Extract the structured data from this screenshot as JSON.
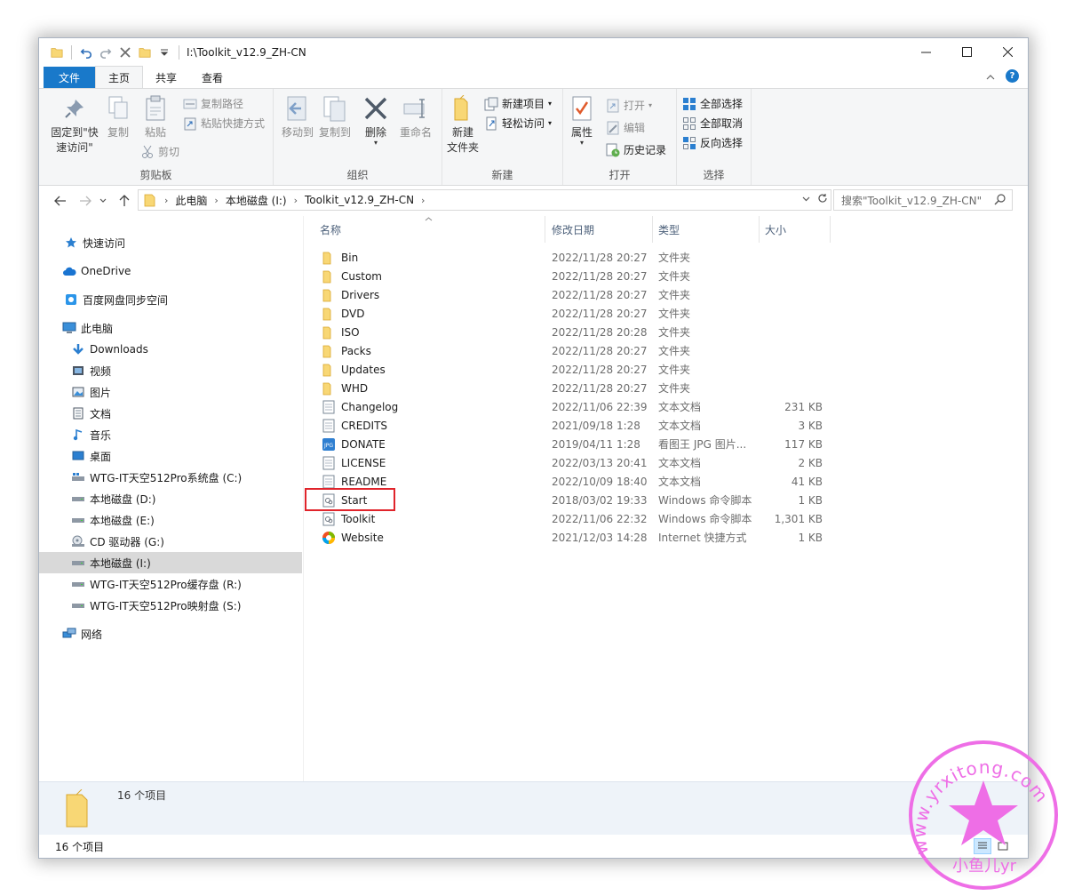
{
  "window": {
    "title": "I:\\Toolkit_v12.9_ZH-CN"
  },
  "tabs": [
    {
      "label": "文件"
    },
    {
      "label": "主页"
    },
    {
      "label": "共享"
    },
    {
      "label": "查看"
    }
  ],
  "ribbon": {
    "clipboard": {
      "pin_line1": "固定到\"快",
      "pin_line2": "速访问\"",
      "copy": "复制",
      "paste": "粘贴",
      "copy_path": "复制路径",
      "paste_shortcut": "粘贴快捷方式",
      "cut": "剪切",
      "label": "剪贴板"
    },
    "organize": {
      "move_to": "移动到",
      "copy_to": "复制到",
      "delete": "删除",
      "rename": "重命名",
      "label": "组织"
    },
    "new": {
      "new_folder_line1": "新建",
      "new_folder_line2": "文件夹",
      "new_item": "新建项目",
      "easy_access": "轻松访问",
      "label": "新建"
    },
    "open": {
      "properties": "属性",
      "open": "打开",
      "edit": "编辑",
      "history": "历史记录",
      "label": "打开"
    },
    "select": {
      "select_all": "全部选择",
      "select_none": "全部取消",
      "invert": "反向选择",
      "label": "选择"
    }
  },
  "address": {
    "crumbs": [
      "此电脑",
      "本地磁盘 (I:)",
      "Toolkit_v12.9_ZH-CN"
    ],
    "search_placeholder": "搜索\"Toolkit_v12.9_ZH-CN\""
  },
  "nav": {
    "items": [
      {
        "label": "快速访问",
        "icon": "star-icon"
      },
      {
        "label": "OneDrive",
        "icon": "cloud-icon"
      },
      {
        "label": "百度网盘同步空间",
        "icon": "baidu-icon"
      },
      {
        "label": "此电脑",
        "icon": "computer-icon"
      },
      {
        "label": "Downloads",
        "icon": "download-icon"
      },
      {
        "label": "视频",
        "icon": "video-icon"
      },
      {
        "label": "图片",
        "icon": "picture-icon"
      },
      {
        "label": "文档",
        "icon": "document-icon"
      },
      {
        "label": "音乐",
        "icon": "music-icon"
      },
      {
        "label": "桌面",
        "icon": "desktop-icon"
      },
      {
        "label": "WTG-IT天空512Pro系统盘 (C:)",
        "icon": "system-drive-icon"
      },
      {
        "label": "本地磁盘 (D:)",
        "icon": "drive-icon"
      },
      {
        "label": "本地磁盘 (E:)",
        "icon": "drive-icon"
      },
      {
        "label": "CD 驱动器 (G:)",
        "icon": "cd-drive-icon"
      },
      {
        "label": "本地磁盘 (I:)",
        "icon": "drive-icon"
      },
      {
        "label": "WTG-IT天空512Pro缓存盘 (R:)",
        "icon": "drive-icon"
      },
      {
        "label": "WTG-IT天空512Pro映射盘 (S:)",
        "icon": "drive-icon"
      },
      {
        "label": "网络",
        "icon": "network-icon"
      }
    ]
  },
  "columns": {
    "name": "名称",
    "date": "修改日期",
    "type": "类型",
    "size": "大小"
  },
  "files": [
    {
      "name": "Bin",
      "date": "2022/11/28 20:27",
      "type": "文件夹",
      "size": "",
      "icon": "folder-icon"
    },
    {
      "name": "Custom",
      "date": "2022/11/28 20:27",
      "type": "文件夹",
      "size": "",
      "icon": "folder-icon"
    },
    {
      "name": "Drivers",
      "date": "2022/11/28 20:27",
      "type": "文件夹",
      "size": "",
      "icon": "folder-icon"
    },
    {
      "name": "DVD",
      "date": "2022/11/28 20:27",
      "type": "文件夹",
      "size": "",
      "icon": "folder-icon"
    },
    {
      "name": "ISO",
      "date": "2022/11/28 20:28",
      "type": "文件夹",
      "size": "",
      "icon": "folder-icon"
    },
    {
      "name": "Packs",
      "date": "2022/11/28 20:27",
      "type": "文件夹",
      "size": "",
      "icon": "folder-icon"
    },
    {
      "name": "Updates",
      "date": "2022/11/28 20:27",
      "type": "文件夹",
      "size": "",
      "icon": "folder-icon"
    },
    {
      "name": "WHD",
      "date": "2022/11/28 20:27",
      "type": "文件夹",
      "size": "",
      "icon": "folder-icon"
    },
    {
      "name": "Changelog",
      "date": "2022/11/06 22:39",
      "type": "文本文档",
      "size": "231 KB",
      "icon": "text-file-icon"
    },
    {
      "name": "CREDITS",
      "date": "2021/09/18 1:28",
      "type": "文本文档",
      "size": "3 KB",
      "icon": "text-file-icon"
    },
    {
      "name": "DONATE",
      "date": "2019/04/11 1:28",
      "type": "看图王 JPG 图片...",
      "size": "117 KB",
      "icon": "jpg-file-icon"
    },
    {
      "name": "LICENSE",
      "date": "2022/03/13 20:41",
      "type": "文本文档",
      "size": "2 KB",
      "icon": "text-file-icon"
    },
    {
      "name": "README",
      "date": "2022/10/09 18:40",
      "type": "文本文档",
      "size": "41 KB",
      "icon": "text-file-icon"
    },
    {
      "name": "Start",
      "date": "2018/03/02 19:33",
      "type": "Windows 命令脚本",
      "size": "1 KB",
      "icon": "script-file-icon"
    },
    {
      "name": "Toolkit",
      "date": "2022/11/06 22:32",
      "type": "Windows 命令脚本",
      "size": "1,301 KB",
      "icon": "script-file-icon"
    },
    {
      "name": "Website",
      "date": "2021/12/03 14:28",
      "type": "Internet 快捷方式",
      "size": "1 KB",
      "icon": "internet-shortcut-icon"
    }
  ],
  "details": {
    "count": "16 个项目"
  },
  "status": {
    "count": "16 个项目"
  },
  "watermark": {
    "text": "www.yrxitong.com",
    "text2": "小鱼儿yr"
  },
  "colors": {
    "accent": "#1979ca",
    "highlight_box": "#e0242b",
    "watermark": "#ee6ee6",
    "folder": "#f8d775"
  }
}
